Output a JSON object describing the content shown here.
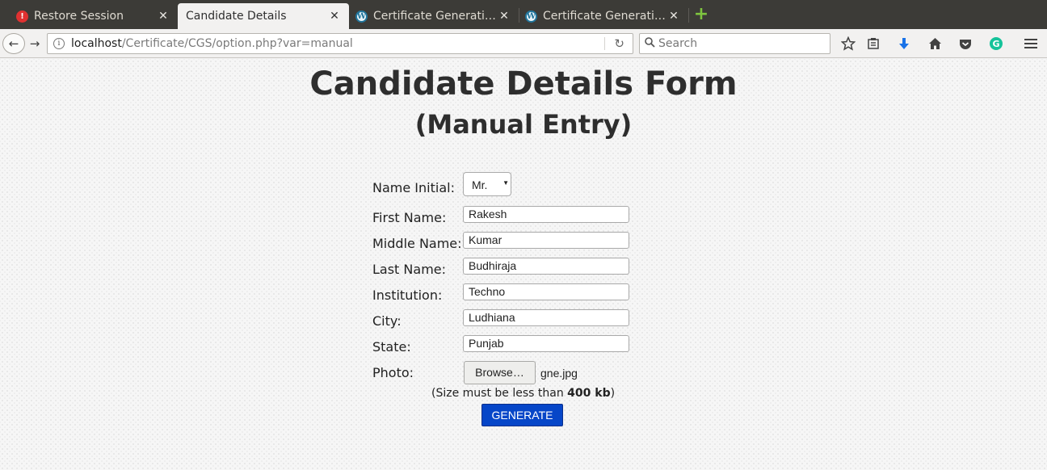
{
  "browser": {
    "tabs": [
      {
        "title": "Restore Session",
        "icon": "alert-icon",
        "active": false
      },
      {
        "title": "Candidate Details",
        "icon": "none",
        "active": true
      },
      {
        "title": "Certificate Generati…",
        "icon": "wordpress-icon",
        "active": false
      },
      {
        "title": "Certificate Generati…",
        "icon": "wordpress-icon",
        "active": false
      }
    ],
    "close_glyph": "✕",
    "url_host": "localhost",
    "url_path": "/Certificate/CGS/option.php?var=manual",
    "search_placeholder": "Search"
  },
  "form": {
    "title": "Candidate Details Form",
    "subtitle": "(Manual Entry)",
    "name_initial_label": "Name Initial:",
    "name_initial_value": "Mr.",
    "first_name_label": "First Name:",
    "first_name_value": "Rakesh",
    "middle_name_label": "Middle Name:",
    "middle_name_value": "Kumar",
    "last_name_label": "Last Name:",
    "last_name_value": "Budhiraja",
    "institution_label": "Institution:",
    "institution_value": "Techno",
    "city_label": "City:",
    "city_value": "Ludhiana",
    "state_label": "State:",
    "state_value": "Punjab",
    "photo_label": "Photo:",
    "browse_label": "Browse…",
    "file_name": "gne.jpg",
    "size_note_prefix": "(Size must be less than ",
    "size_note_bold": "400 kb",
    "size_note_suffix": ")",
    "generate_label": "GENERATE"
  },
  "colors": {
    "generate_button": "#0646c8",
    "tabbar": "#3c3b37"
  }
}
